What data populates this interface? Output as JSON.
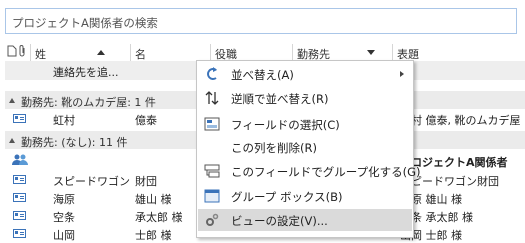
{
  "search": {
    "placeholder": "プロジェクトA関係者の検索"
  },
  "columns": [
    {
      "label": "姓"
    },
    {
      "label": "名"
    },
    {
      "label": "役職"
    },
    {
      "label": "勤務先"
    },
    {
      "label": "表題"
    }
  ],
  "add_contact_label": "連絡先を追...",
  "groups": [
    {
      "label": "勤務先: 靴のムカデ屋: 1 件"
    },
    {
      "label": "勤務先: (なし): 11 件"
    }
  ],
  "rows": [
    {
      "last": "虹村",
      "first": "億泰",
      "title": "虹村 億泰, 靴のムカデ屋"
    },
    {
      "last": "",
      "first": "",
      "title": "プロジェクトA関係者"
    },
    {
      "last": "スピードワゴン",
      "first": "財団",
      "title": "スピードワゴン財団"
    },
    {
      "last": "海原",
      "first": "雄山 様",
      "title": "海原 雄山 様"
    },
    {
      "last": "空条",
      "first": "承太郎 様",
      "title": "空条 承太郎 様"
    },
    {
      "last": "山岡",
      "first": "士郎 様",
      "title": "山岡 士郎 様"
    }
  ],
  "context_menu": {
    "items": [
      {
        "label": "並べ替え(A)",
        "icon": "sort-icon",
        "submenu": true
      },
      {
        "label": "逆順で並べ替え(R)",
        "icon": "reverse-sort-icon"
      },
      {
        "label": "フィールドの選択(C)",
        "icon": "field-chooser-icon"
      },
      {
        "label": "この列を削除(R)",
        "icon": ""
      },
      {
        "label": "このフィールドでグループ化する(G)",
        "icon": "group-by-field-icon"
      },
      {
        "label": "グループ ボックス(B)",
        "icon": "group-box-icon"
      },
      {
        "label": "ビューの設定(V)...",
        "icon": "view-settings-icon"
      }
    ]
  },
  "colors": {
    "accent": "#3b73b9",
    "highlight": "#dadada",
    "group_bg": "#ebebeb"
  }
}
